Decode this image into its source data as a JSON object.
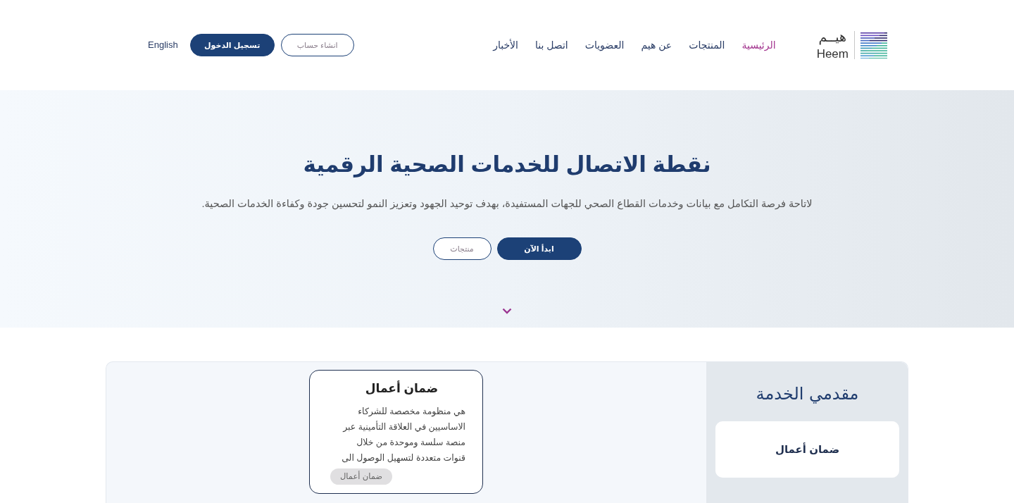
{
  "header": {
    "logo": {
      "name": "هيــم",
      "latin_name": "Heem"
    },
    "nav": [
      {
        "label": "الرئيسية",
        "selected": true
      },
      {
        "label": "المنتجات",
        "selected": false
      },
      {
        "label": "عن هيم",
        "selected": false
      },
      {
        "label": "العضويات",
        "selected": false
      },
      {
        "label": "اتصل بنا",
        "selected": false
      },
      {
        "label": "الأخبار",
        "selected": false
      }
    ],
    "buttons": [
      {
        "label": "انشاء حساب",
        "kind": "outline"
      },
      {
        "label": "تسجيل الدخول",
        "kind": "filled"
      }
    ],
    "language": "English"
  },
  "hero": {
    "title": "نقطة الاتصال للخدمات الصحية الرقمية",
    "subtitle": "لاتاحة فرصة التكامل مع بيانات وخدمات القطاع الصحي للجهات المستفيدة، بهدف توحيد الجهود وتعزيز النمو لتحسين جودة وكفاءة الخدمات الصحية.",
    "buttons": [
      {
        "label": "ابدأ الآن",
        "kind": "filled"
      },
      {
        "label": "منتجات",
        "kind": "outline"
      }
    ]
  },
  "providers": {
    "title": "مقدمي الخدمة",
    "items": [
      {
        "label": "ضمان أعمال"
      }
    ]
  },
  "products": [
    {
      "title": "ضمان أعمال",
      "description": "هي منظومة مخصصة للشركاء الاساسيين في العلاقة التأمينية عبر منصة سلسة وموحدة من خلال قنوات متعددة لتسهيل الوصول الى",
      "tag": "ضمان أعمال"
    }
  ]
}
